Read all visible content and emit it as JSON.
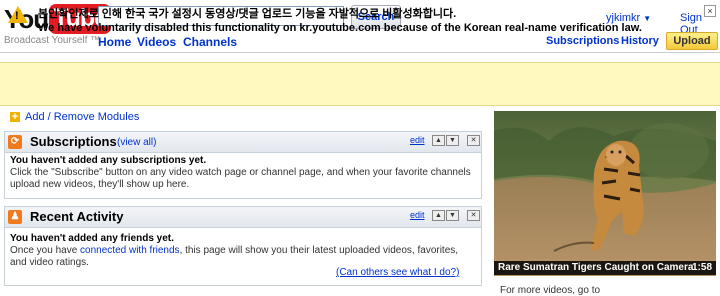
{
  "header": {
    "logo_you": "You",
    "logo_tube": "Tube",
    "tagline": "Broadcast Yourself ™",
    "search": {
      "value": "",
      "button_label": "Search"
    },
    "nav": [
      "Home",
      "Videos",
      "Channels"
    ],
    "user": {
      "username": "yjkimkr",
      "sign_out": "Sign Out"
    },
    "right_nav": [
      "Subscriptions",
      "History"
    ],
    "upload_label": "Upload"
  },
  "notice": {
    "line_ko": "본인확인제로 인해 한국 국가 설정시 동영상/댓글 업로드 기능을 자발적으로 비활성화합니다.",
    "line_en": "We have voluntarily disabled this functionality on kr.youtube.com because of the Korean real-name verification law.",
    "close": "×"
  },
  "add_modules": "Add / Remove Modules",
  "subscriptions": {
    "title": "Subscriptions",
    "view_all": "(view all)",
    "edit": "edit",
    "bold": "You haven't added any subscriptions yet.",
    "body": "Click the \"Subscribe\" button on any video watch page or channel page, and when your favorite channels upload new videos, they'll show up here."
  },
  "activity": {
    "title": "Recent Activity",
    "edit": "edit",
    "bold": "You haven't added any friends yet.",
    "body_pre": "Once you have ",
    "body_link": "connected with friends",
    "body_post": ", this page will show you their latest uploaded videos, favorites, and video ratings.",
    "others": "(Can others see what I do?)"
  },
  "video": {
    "title": "Rare Sumatran Tigers Caught on Camera",
    "time": "1:58",
    "more": "For more videos, go to"
  },
  "colors": {
    "link": "#0033cc",
    "notice_bg": "#fff9c0",
    "brand_red": "#e31b23",
    "upload_yellow": "#f5c83a"
  }
}
